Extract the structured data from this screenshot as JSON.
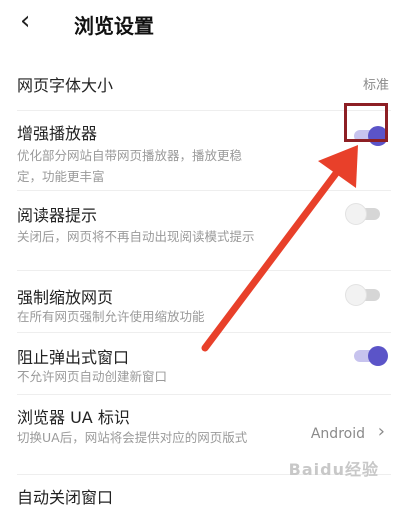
{
  "header": {
    "back_icon": "‹",
    "title": "浏览设置"
  },
  "rows": [
    {
      "label": "网页字体大小",
      "value": "标准"
    },
    {
      "label": "增强播放器",
      "desc": "优化部分网站自带网页播放器，播放更稳定，功能更丰富",
      "toggle": "on"
    },
    {
      "label": "阅读器提示",
      "desc": "关闭后，网页将不再自动出现阅读模式提示",
      "toggle": "off"
    },
    {
      "label": "强制缩放网页",
      "desc": "在所有网页强制允许使用缩放功能",
      "toggle": "off"
    },
    {
      "label": "阻止弹出式窗口",
      "desc": "不允许网页自动创建新窗口",
      "toggle": "on"
    },
    {
      "label": "浏览器 UA 标识",
      "desc": "切换UA后，网站将会提供对应的网页版式",
      "value": "Android",
      "chevron": "›"
    },
    {
      "label": "自动关闭窗口"
    }
  ],
  "colors": {
    "toggle_on": "#5b54c8",
    "annotation": "#e8402a",
    "highlight_box": "#8d1f24"
  },
  "watermark": "Baidu经验"
}
